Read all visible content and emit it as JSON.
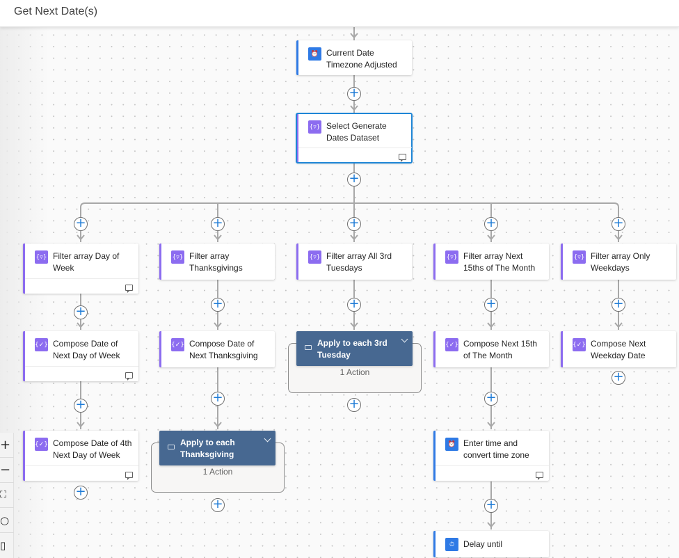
{
  "header": {
    "title": "Get Next Date(s)"
  },
  "nodes": {
    "current_date": {
      "title": "Current Date Timezone Adjusted",
      "icon": "clock-icon",
      "type": "blue"
    },
    "select_dates": {
      "title": "Select Generate Dates Dataset",
      "icon": "data-operation-icon",
      "type": "purple"
    },
    "filter_day_of_week": {
      "title": "Filter array Day of Week",
      "icon": "filter-icon"
    },
    "compose_next_day_of_week": {
      "title": "Compose Date of Next Day of Week",
      "icon": "compose-icon"
    },
    "compose_4th_day_of_week": {
      "title": "Compose Date of 4th Next Day of Week",
      "icon": "compose-icon"
    },
    "filter_thanksgivings": {
      "title": "Filter array Thanksgivings",
      "icon": "filter-icon"
    },
    "compose_next_thanksgiving": {
      "title": "Compose Date of Next Thanksgiving",
      "icon": "compose-icon"
    },
    "apply_each_thanksgiving": {
      "title": "Apply to each Thanksgiving",
      "actions": "1 Action"
    },
    "filter_3rd_tuesdays": {
      "title": "Filter array All 3rd Tuesdays",
      "icon": "filter-icon"
    },
    "apply_each_3rd_tuesday": {
      "title": "Apply to each 3rd Tuesday",
      "actions": "1 Action"
    },
    "filter_15ths": {
      "title": "Filter array Next 15ths of The Month",
      "icon": "filter-icon"
    },
    "compose_next_15th": {
      "title": "Compose Next 15th of The Month",
      "icon": "compose-icon"
    },
    "enter_time_convert": {
      "title": "Enter time and convert time zone",
      "icon": "clock-icon"
    },
    "delay_until": {
      "title": "Delay until",
      "icon": "timer-icon"
    },
    "filter_weekdays": {
      "title": "Filter array Only Weekdays",
      "icon": "filter-icon"
    },
    "compose_next_weekday": {
      "title": "Compose Next Weekday Date",
      "icon": "compose-icon"
    }
  },
  "glyphs": {
    "add": "+",
    "filter": "{▿}",
    "compose": "{✓}",
    "clock": "⏰",
    "timer": "⏱",
    "zoom_in": "+",
    "zoom_out": "−",
    "fit": "⛶",
    "search": "○",
    "map": "▯"
  },
  "toolbar": {
    "zoom_in": "Zoom in",
    "zoom_out": "Zoom out",
    "fit_view": "Fit view",
    "search": "Search",
    "minimap": "Minimap"
  }
}
